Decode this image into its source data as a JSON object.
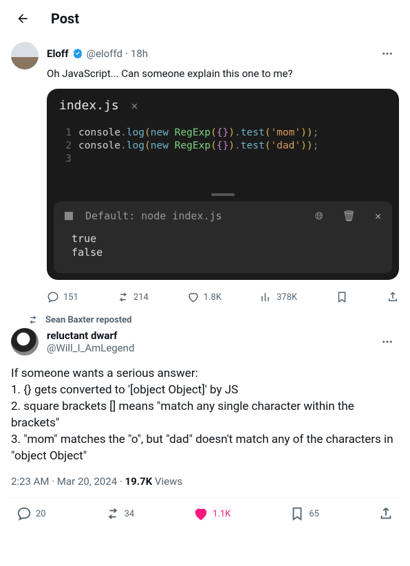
{
  "header": {
    "title": "Post"
  },
  "quoted": {
    "display_name": "Eloff",
    "handle": "@eloffd",
    "time": "18h",
    "text": "Oh JavaScript... Can someone explain this one to me?",
    "code": {
      "filename": "index.js",
      "lines": [
        {
          "n": "1",
          "tokens": "console.log(new RegExp({}).test('mom'));"
        },
        {
          "n": "2",
          "tokens": "console.log(new RegExp({}).test('dad'));"
        },
        {
          "n": "3",
          "tokens": ""
        }
      ],
      "terminal_title": "Default: node index.js",
      "output": [
        "true",
        "false"
      ]
    },
    "actions": {
      "replies": "151",
      "reposts": "214",
      "likes": "1.8K",
      "views": "378K"
    }
  },
  "repost_by": "Sean Baxter reposted",
  "main": {
    "display_name": "reluctant dwarf",
    "handle": "@Will_I_AmLegend",
    "text_lines": [
      "If someone wants a serious answer:",
      "1. {} gets converted to '[object Object]' by JS",
      "2. square brackets [] means \"match any single character within the brackets\"",
      "3. \"mom\" matches the \"o\", but \"dad\" doesn't match any of the characters in \"object Object\""
    ],
    "time": "2:23 AM",
    "date": "Mar 20, 2024",
    "views_count": "19.7K",
    "views_label": "Views",
    "actions": {
      "replies": "20",
      "reposts": "34",
      "likes": "1.1K",
      "bookmarks": "65"
    }
  }
}
